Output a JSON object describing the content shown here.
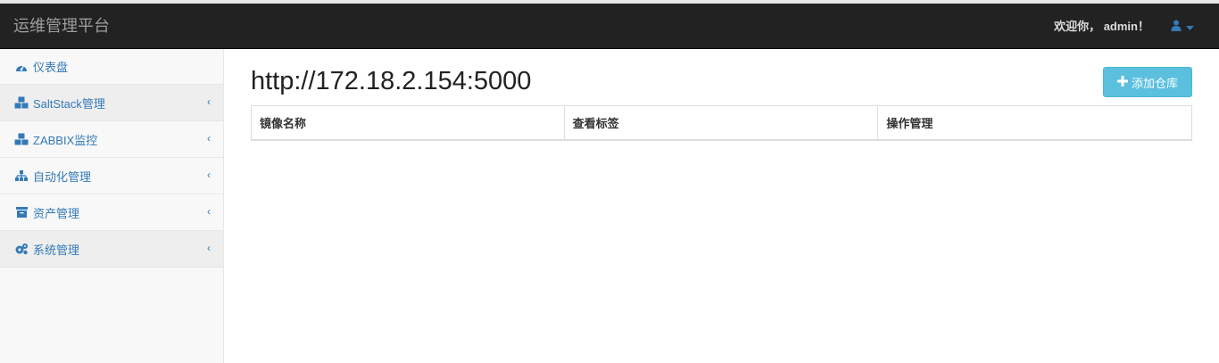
{
  "header": {
    "brand": "运维管理平台",
    "welcome": "欢迎你， admin！",
    "user_icon": "user-icon",
    "caret_icon": "caret-down-icon"
  },
  "sidebar": {
    "items": [
      {
        "label": "仪表盘",
        "icon": "dashboard-icon",
        "expandable": false
      },
      {
        "label": "SaltStack管理",
        "icon": "cubes-icon",
        "expandable": true
      },
      {
        "label": "ZABBIX监控",
        "icon": "cubes-icon",
        "expandable": true
      },
      {
        "label": "自动化管理",
        "icon": "sitemap-icon",
        "expandable": true
      },
      {
        "label": "资产管理",
        "icon": "archive-icon",
        "expandable": true
      },
      {
        "label": "系统管理",
        "icon": "cogs-icon",
        "expandable": true
      }
    ],
    "chevron": "‹"
  },
  "main": {
    "title": "http://172.18.2.154:5000",
    "add_button": "添加仓库",
    "table": {
      "columns": [
        "镜像名称",
        "查看标签",
        "操作管理"
      ],
      "rows": []
    }
  },
  "colors": {
    "navbar": "#222222",
    "link": "#337ab7",
    "info_button": "#5bc0de"
  }
}
